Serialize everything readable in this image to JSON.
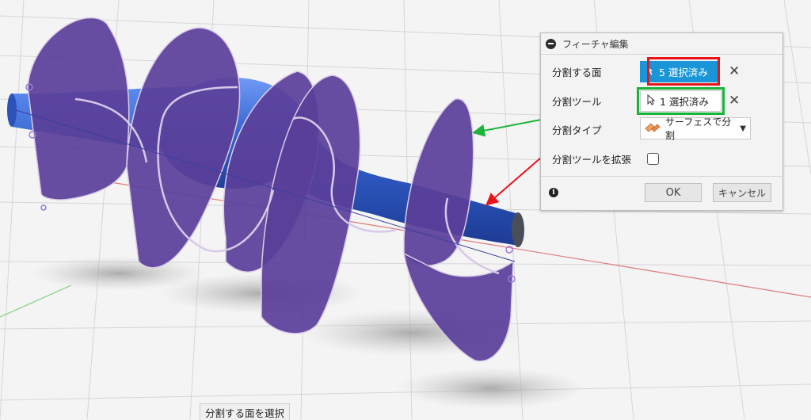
{
  "panel": {
    "title": "フィーチャ編集",
    "rows": {
      "split_faces_label": "分割する面",
      "split_faces_value": "5 選択済み",
      "split_tool_label": "分割ツール",
      "split_tool_value": "1 選択済み",
      "split_type_label": "分割タイプ",
      "split_type_value": "サーフェスで分割",
      "extend_tool_label": "分割ツールを拡張"
    },
    "ok_label": "OK",
    "cancel_label": "キャンセル"
  },
  "status": {
    "prompt": "分割する面を選択"
  },
  "colors": {
    "surface": "#5a3f9a",
    "body": "#2f5ec8",
    "select_blue": "#1a96d8",
    "highlight_red": "#e8141a",
    "highlight_green": "#1bb43a"
  }
}
